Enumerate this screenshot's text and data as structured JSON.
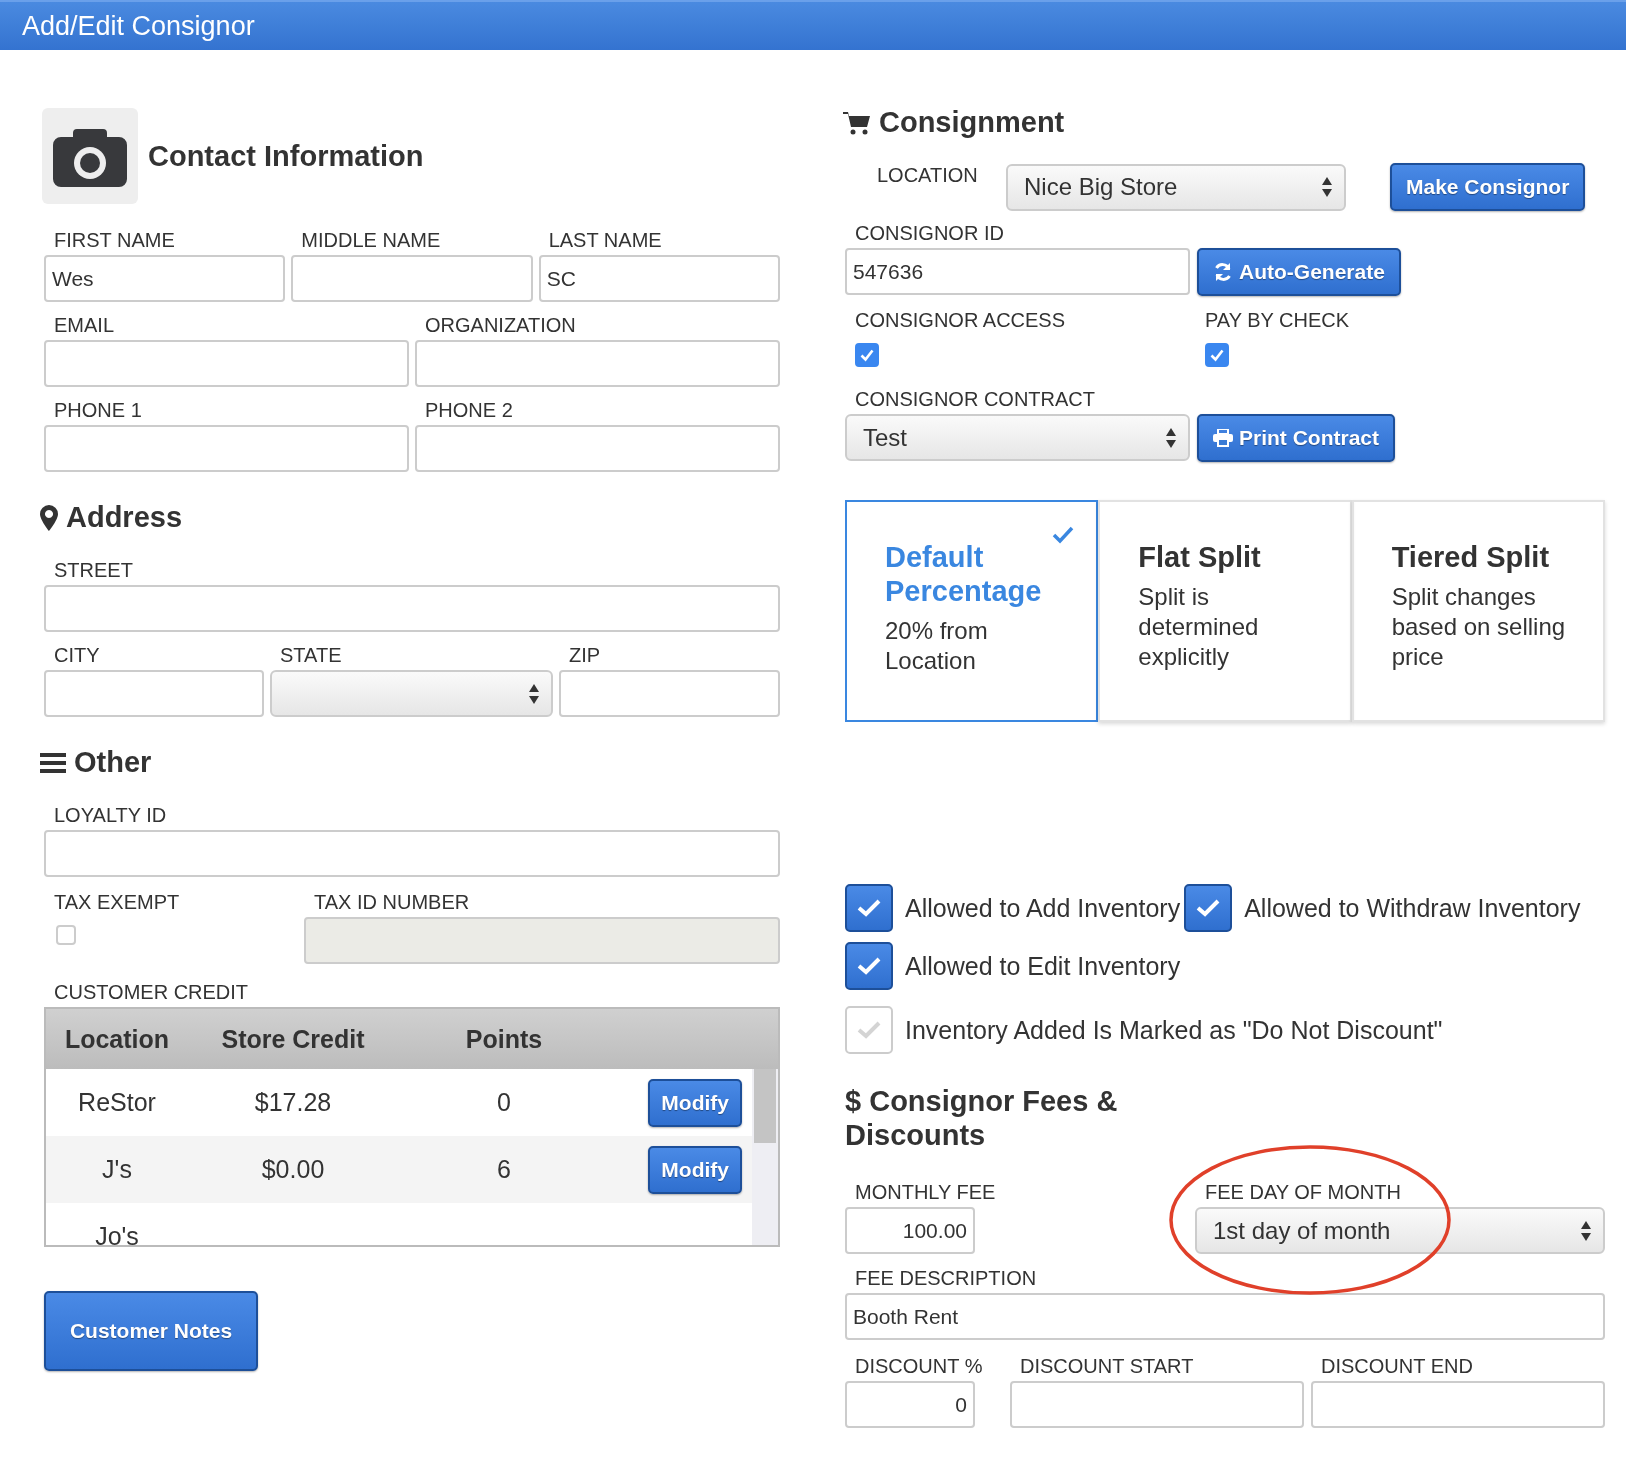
{
  "window": {
    "title": "Add/Edit Consignor"
  },
  "contact": {
    "heading": "Contact Information",
    "rows": [
      [
        {
          "label": "FIRST NAME",
          "value": "Wes"
        },
        {
          "label": "MIDDLE NAME"
        },
        {
          "label": "LAST NAME",
          "value": "SC"
        }
      ],
      [
        {
          "label": "EMAIL"
        },
        {
          "label": "ORGANIZATION"
        }
      ],
      [
        {
          "label": "PHONE 1"
        },
        {
          "label": "PHONE 2"
        }
      ]
    ]
  },
  "address": {
    "heading": "Address",
    "rows": [
      [
        {
          "label": "STREET",
          "kind": "text"
        }
      ],
      [
        {
          "label": "CITY",
          "kind": "text"
        },
        {
          "label": "STATE",
          "kind": "select"
        },
        {
          "label": "ZIP",
          "kind": "text"
        }
      ]
    ]
  },
  "other": {
    "heading": "Other",
    "loyalty": {
      "label": "LOYALTY ID"
    },
    "tax_exempt": {
      "label": "TAX EXEMPT",
      "checked": false
    },
    "tax_id": {
      "label": "TAX ID NUMBER",
      "disabled": true
    },
    "credit_label": "CUSTOMER CREDIT"
  },
  "credit_table": {
    "columns": [
      "Location",
      "Store Credit",
      "Points"
    ],
    "rows": [
      {
        "location": "ReStor",
        "credit": "$17.28",
        "points": "0",
        "action": "Modify"
      },
      {
        "location": "J's",
        "credit": "$0.00",
        "points": "6",
        "action": "Modify"
      },
      {
        "location": "Jo's"
      }
    ]
  },
  "notes_button": "Customer Notes",
  "consignment": {
    "heading": "Consignment",
    "location": {
      "label": "LOCATION",
      "value": "Nice Big Store"
    },
    "make_button": "Make Consignor",
    "id": {
      "label": "CONSIGNOR ID",
      "value": "547636"
    },
    "autogen_button": "Auto-Generate",
    "access": {
      "label": "CONSIGNOR ACCESS",
      "checked": true
    },
    "pay_by_check": {
      "label": "PAY BY CHECK",
      "checked": true
    },
    "contract": {
      "label": "CONSIGNOR CONTRACT",
      "value": "Test"
    },
    "print_button": "Print Contract"
  },
  "split_options": [
    {
      "title": "Default Percentage",
      "description": "20% from Location",
      "selected": true
    },
    {
      "title": "Flat Split",
      "description": "Split is determined explicitly",
      "selected": false
    },
    {
      "title": "Tiered Split",
      "description": "Split changes based on selling price",
      "selected": false
    }
  ],
  "permissions": [
    {
      "label": "Allowed to Add Inventory",
      "checked": true
    },
    {
      "label": "Allowed to Withdraw Inventory",
      "checked": true
    },
    {
      "label": "Allowed to Edit Inventory",
      "checked": true
    },
    {
      "label": "Inventory Added Is Marked as \"Do Not Discount\"",
      "checked": false
    }
  ],
  "fees": {
    "symbol": "$",
    "heading": "Consignor Fees & Discounts",
    "monthly_fee": {
      "label": "MONTHLY FEE",
      "value": "100.00"
    },
    "fee_day": {
      "label": "FEE DAY OF MONTH",
      "value": "1st day of month",
      "highlighted": true
    },
    "description": {
      "label": "FEE DESCRIPTION",
      "value": "Booth Rent"
    },
    "discount": {
      "label": "DISCOUNT %",
      "value": "0"
    },
    "discount_start": {
      "label": "DISCOUNT START"
    },
    "discount_end": {
      "label": "DISCOUNT END"
    }
  }
}
